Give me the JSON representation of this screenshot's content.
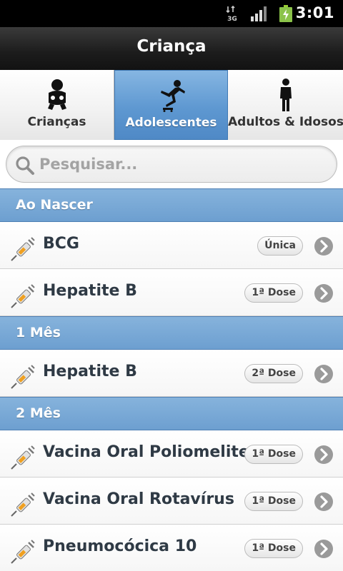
{
  "status_bar": {
    "network": "3G",
    "time": "3:01"
  },
  "header": {
    "title": "Criança"
  },
  "tabs": [
    {
      "label": "Crianças",
      "icon": "baby-icon",
      "active": false
    },
    {
      "label": "Adolescentes",
      "icon": "skater-icon",
      "active": true
    },
    {
      "label": "Adultos & Idosos",
      "icon": "adult-person-icon",
      "active": false
    }
  ],
  "search": {
    "placeholder": "Pesquisar...",
    "value": ""
  },
  "sections": [
    {
      "title": "Ao Nascer",
      "items": [
        {
          "name": "BCG",
          "dose": "Única"
        },
        {
          "name": "Hepatite B",
          "dose": "1ª Dose"
        }
      ]
    },
    {
      "title": "1 Mês",
      "items": [
        {
          "name": "Hepatite B",
          "dose": "2ª Dose"
        }
      ]
    },
    {
      "title": "2 Mês",
      "items": [
        {
          "name": "Vacina Oral Poliomelite",
          "dose": "1ª Dose"
        },
        {
          "name": "Vacina Oral Rotavírus",
          "dose": "1ª Dose"
        },
        {
          "name": "Pneumocócica 10",
          "dose": "1ª Dose"
        }
      ]
    }
  ],
  "colors": {
    "section_blue": "#6d9fd0",
    "active_tab": "#5e98d1",
    "title_bar": "#1c1c1c"
  }
}
